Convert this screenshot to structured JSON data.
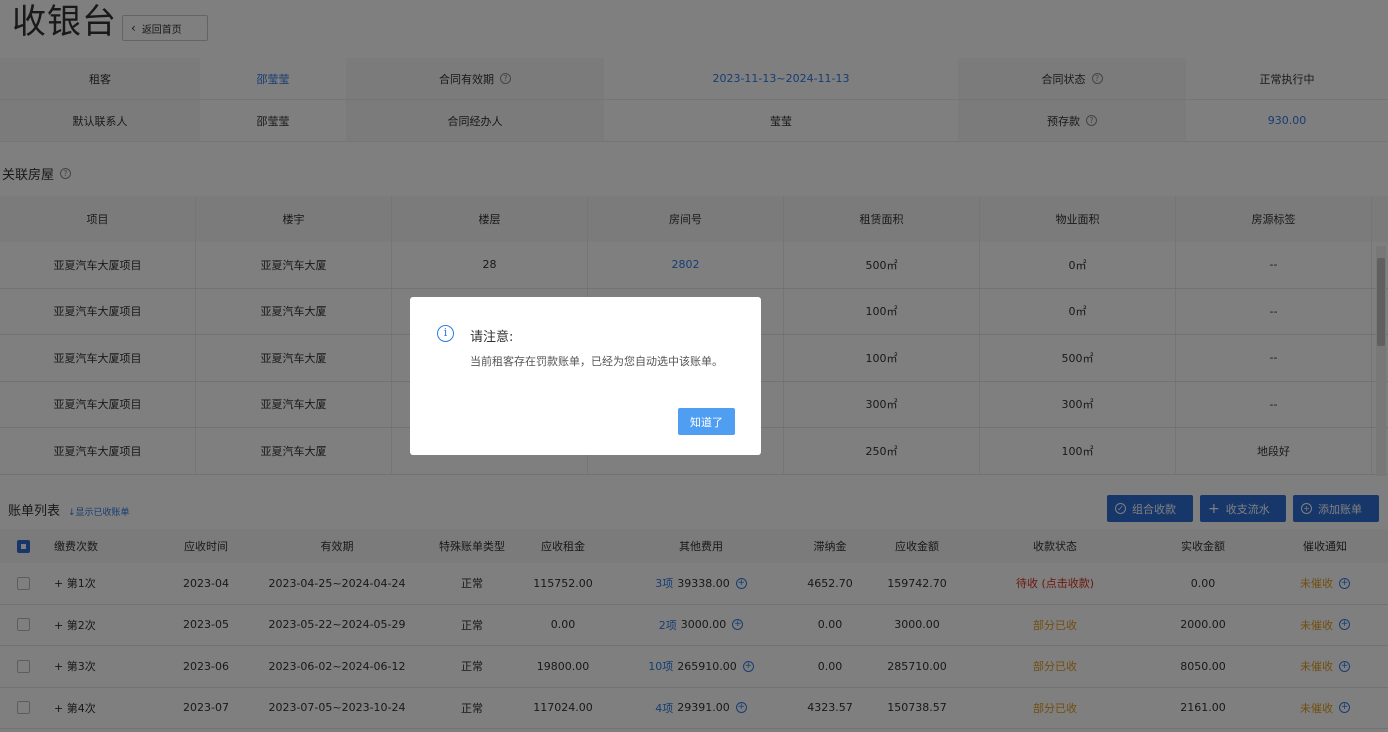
{
  "header": {
    "title": "收银台",
    "back_label": "返回首页"
  },
  "info": {
    "rows": [
      {
        "l1": "租客",
        "v1": "邵莹莹",
        "l2": "合同有效期",
        "v2": "2023-11-13~2024-11-13",
        "l3": "合同状态",
        "v3": "正常执行中"
      },
      {
        "l1": "默认联系人",
        "v1": "邵莹莹",
        "l2": "合同经办人",
        "v2": "莹莹",
        "l3": "预存款",
        "v3": "930.00"
      }
    ]
  },
  "rooms": {
    "section_title": "关联房屋",
    "headers": [
      "项目",
      "楼宇",
      "楼层",
      "房间号",
      "租赁面积",
      "物业面积",
      "房源标签"
    ],
    "rows": [
      [
        "亚夏汽车大厦项目",
        "亚夏汽车大厦",
        "28",
        "2802",
        "500㎡",
        "0㎡",
        "--"
      ],
      [
        "亚夏汽车大厦项目",
        "亚夏汽车大厦",
        "",
        "",
        "100㎡",
        "0㎡",
        "--"
      ],
      [
        "亚夏汽车大厦项目",
        "亚夏汽车大厦",
        "",
        "",
        "100㎡",
        "500㎡",
        "--"
      ],
      [
        "亚夏汽车大厦项目",
        "亚夏汽车大厦",
        "",
        "",
        "300㎡",
        "300㎡",
        "--"
      ],
      [
        "亚夏汽车大厦项目",
        "亚夏汽车大厦",
        "",
        "",
        "250㎡",
        "100㎡",
        "地段好"
      ]
    ]
  },
  "bills": {
    "title": "账单列表",
    "show_paid_link": "显示已收账单",
    "buttons": {
      "combine": "组合收款",
      "flow": "收支流水",
      "add": "添加账单"
    },
    "headers": [
      "缴费次数",
      "应收时间",
      "有效期",
      "特殊账单类型",
      "应收租金",
      "其他费用",
      "滞纳金",
      "应收金额",
      "收款状态",
      "实收金额",
      "催收通知"
    ],
    "rows": [
      {
        "no": "+ 第1次",
        "time": "2023-04",
        "period": "2023-04-25~2024-04-24",
        "type": "正常",
        "rent": "115752.00",
        "other_count": "3项",
        "other_amount": "39338.00",
        "late": "4652.70",
        "total": "159742.70",
        "status": "待收 (点击收款)",
        "paid": "0.00",
        "notice": "未催收"
      },
      {
        "no": "+ 第2次",
        "time": "2023-05",
        "period": "2023-05-22~2024-05-29",
        "type": "正常",
        "rent": "0.00",
        "other_count": "2项",
        "other_amount": "3000.00",
        "late": "0.00",
        "total": "3000.00",
        "status": "部分已收",
        "paid": "2000.00",
        "notice": "未催收"
      },
      {
        "no": "+ 第3次",
        "time": "2023-06",
        "period": "2023-06-02~2024-06-12",
        "type": "正常",
        "rent": "19800.00",
        "other_count": "10项",
        "other_amount": "265910.00",
        "late": "0.00",
        "total": "285710.00",
        "status": "部分已收",
        "paid": "8050.00",
        "notice": "未催收"
      },
      {
        "no": "+ 第4次",
        "time": "2023-07",
        "period": "2023-07-05~2023-10-24",
        "type": "正常",
        "rent": "117024.00",
        "other_count": "4项",
        "other_amount": "29391.00",
        "late": "4323.57",
        "total": "150738.57",
        "status": "部分已收",
        "paid": "2161.00",
        "notice": "未催收"
      }
    ]
  },
  "modal": {
    "title": "请注意:",
    "message": "当前租客存在罚款账单，已经为您自动选中该账单。",
    "confirm": "知道了"
  },
  "colors": {
    "accent": "#2f6fd6",
    "link": "#2f7ae5",
    "danger": "#d9311f",
    "warning": "#e39d1f"
  }
}
